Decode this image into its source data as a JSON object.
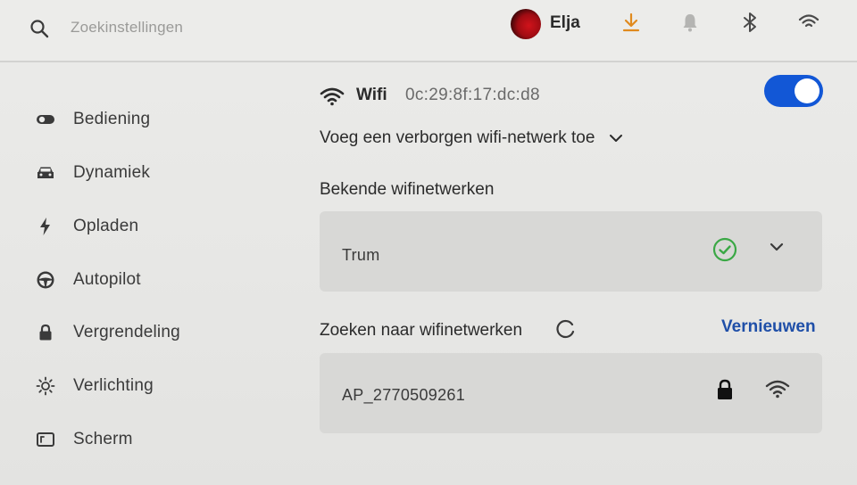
{
  "search": {
    "placeholder": "Zoekinstellingen"
  },
  "user": {
    "name": "Elja"
  },
  "top_icons": [
    "download-icon",
    "bell-icon",
    "bluetooth-icon",
    "wifi-icon"
  ],
  "colors": {
    "accent": "#1257d6",
    "download": "#e08a1e",
    "link": "#1f4fa8",
    "check": "#3aa845"
  },
  "sidebar": {
    "items": [
      {
        "label": "Bediening",
        "icon": "toggle-icon"
      },
      {
        "label": "Dynamiek",
        "icon": "car-icon"
      },
      {
        "label": "Opladen",
        "icon": "bolt-icon"
      },
      {
        "label": "Autopilot",
        "icon": "steering-wheel-icon"
      },
      {
        "label": "Vergrendeling",
        "icon": "lock-icon"
      },
      {
        "label": "Verlichting",
        "icon": "sun-icon"
      },
      {
        "label": "Scherm",
        "icon": "display-icon"
      }
    ]
  },
  "wifi": {
    "title": "Wifi",
    "mac": "0c:29:8f:17:dc:d8",
    "enabled": true,
    "add_hidden_label": "Voeg een verborgen wifi-netwerk toe",
    "known_title": "Bekende wifinetwerken",
    "known_networks": [
      {
        "name": "Trum",
        "connected": true
      }
    ],
    "search_title": "Zoeken naar wifinetwerken",
    "refresh_label": "Vernieuwen",
    "available_networks": [
      {
        "name": "AP_2770509261",
        "secured": true
      }
    ]
  }
}
